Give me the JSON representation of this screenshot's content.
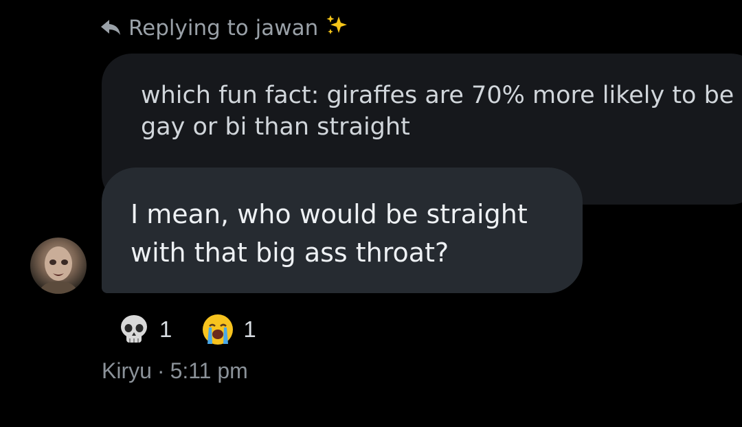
{
  "reply_header": {
    "icon": "reply-arrow-icon",
    "text": "Replying to jawan",
    "emoji": "sparkles"
  },
  "quoted_message": {
    "text": "which fun fact: giraffes are 70% more likely to be gay or bi than straight"
  },
  "message": {
    "text": "I mean, who would be straight with that big ass throat?"
  },
  "reactions": [
    {
      "emoji": "skull",
      "count": "1"
    },
    {
      "emoji": "loudly-crying-face",
      "count": "1"
    }
  ],
  "meta": {
    "sender": "Kiryu",
    "separator": "·",
    "time": "5:11 pm"
  },
  "colors": {
    "background": "#000000",
    "quoted_bubble": "#16181c",
    "message_bubble": "#262b31",
    "muted_text": "#9aa1a8"
  }
}
